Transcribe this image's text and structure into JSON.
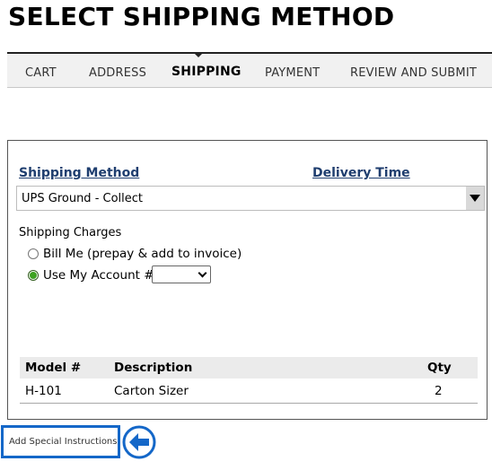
{
  "page": {
    "title": "SELECT SHIPPING METHOD"
  },
  "steps": [
    {
      "label": "CART",
      "active": false
    },
    {
      "label": "ADDRESS",
      "active": false
    },
    {
      "label": "SHIPPING",
      "active": true
    },
    {
      "label": "PAYMENT",
      "active": false
    },
    {
      "label": "REVIEW AND SUBMIT",
      "active": false
    }
  ],
  "shipping": {
    "method_header": "Shipping Method",
    "delivery_header": "Delivery Time",
    "selected_method": "UPS Ground - Collect",
    "charges_label": "Shipping Charges",
    "options": [
      {
        "label": "Bill Me (prepay & add to invoice)",
        "checked": false
      },
      {
        "label": "Use My Account #:",
        "checked": true
      }
    ],
    "account_number": ""
  },
  "items": {
    "headers": {
      "model": "Model #",
      "description": "Description",
      "qty": "Qty"
    },
    "rows": [
      {
        "model": "H-101",
        "description": "Carton Sizer",
        "qty": "2"
      }
    ]
  },
  "actions": {
    "add_instructions": "Add Special Instructions"
  },
  "colors": {
    "link": "#1f3e6f",
    "accent_blue": "#1467c8",
    "radio_green": "#3ea221",
    "tab_bar": "#f1f1f1"
  },
  "icons": {
    "pointer": "arrow-left-circle-icon"
  }
}
